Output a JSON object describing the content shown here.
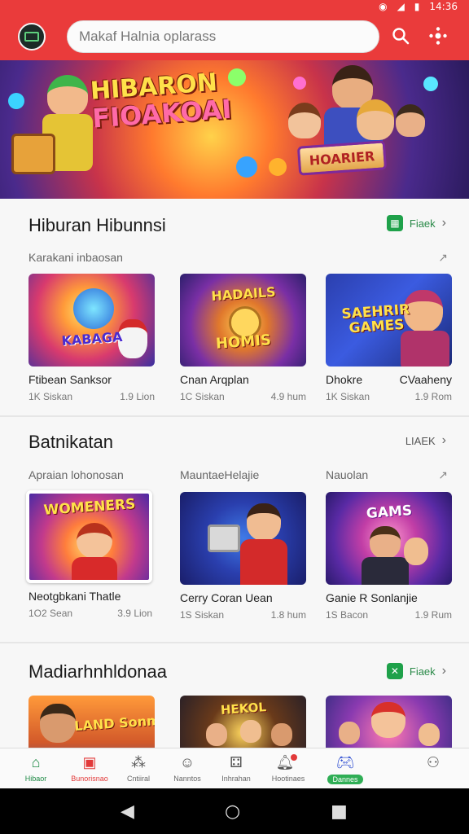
{
  "status_bar": {
    "time": "14:36"
  },
  "header": {
    "search_placeholder": "Makaf Halnia oplarass"
  },
  "banner": {
    "title_line1": "HIBARON",
    "title_line2": "FIOAKOAI",
    "sign_text": "HOARIER"
  },
  "sections": [
    {
      "title": "Hiburan Hibunnsi",
      "more_label": "Fiaek",
      "subtitle": "Karakani inbaosan",
      "cards": [
        {
          "name": "Ftibean Sanksor",
          "meta_left": "1K Siskan",
          "meta_right": "1.9 Lion",
          "tag": "KABAGA"
        },
        {
          "name": "Cnan Arqplan",
          "meta_left": "1C Siskan",
          "meta_right": "4.9 hum",
          "tag": "HOMIS"
        },
        {
          "name": "Dhokre",
          "name_right": "CVaaheny",
          "meta_left": "1K Siskan",
          "meta_right": "1.9 Rom",
          "tag": "SAEHRIR GAMES"
        }
      ]
    },
    {
      "title": "Batnikatan",
      "more_label": "LIAEK",
      "subtitle": "Apraian lohonosan",
      "subtitle_mid": "MauntaeHelajie",
      "subtitle_right": "Nauolan",
      "cards": [
        {
          "name": "Neotgbkani Thatle",
          "meta_left": "1O2 Sean",
          "meta_right": "3.9 Lion",
          "tag": "WOMENERS"
        },
        {
          "name": "Cerry Coran Uean",
          "meta_left": "1S Siskan",
          "meta_right": "1.8 hum",
          "tag": ""
        },
        {
          "name": "Ganie R Sonlanjie",
          "meta_left": "1S Bacon",
          "meta_right": "1.9 Rum",
          "tag": "GAMS"
        }
      ]
    },
    {
      "title": "Madiarhnhldonaa",
      "more_label": "Fiaek",
      "cards": [
        {
          "tag": "LAND Sonm"
        },
        {
          "tag": "HEKOL"
        },
        {
          "tag": ""
        }
      ]
    }
  ],
  "bottom_nav": [
    {
      "label": "Hibaor",
      "icon": "home-icon"
    },
    {
      "label": "Bunorisnao",
      "icon": "store-icon"
    },
    {
      "label": "Cntiiral",
      "icon": "grid-icon"
    },
    {
      "label": "Nanntos",
      "icon": "smile-icon"
    },
    {
      "label": "Inhrahan",
      "icon": "dice-icon"
    },
    {
      "label": "Hootinaes",
      "icon": "bell-icon"
    },
    {
      "label": "Dannes",
      "icon": "games-icon"
    },
    {
      "label": "",
      "icon": "profile-icon"
    }
  ]
}
